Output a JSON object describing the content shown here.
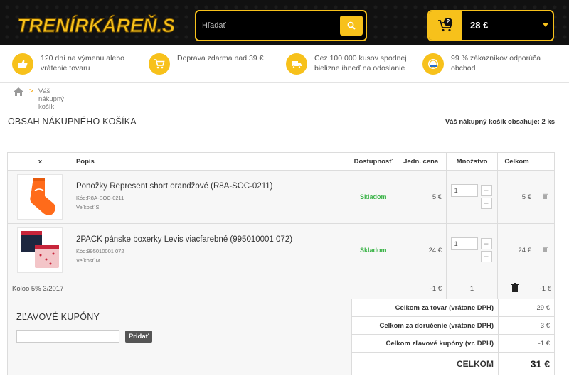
{
  "header": {
    "logo_text": "TRENÍRKÁREŇ.SK",
    "search_placeholder": "Hľadať",
    "cart_count": "2",
    "cart_total": "28 €"
  },
  "benefits": [
    {
      "icon": "thumbs-up-icon",
      "text": "120 dní na výmenu alebo vrátenie tovaru"
    },
    {
      "icon": "cart-icon",
      "text": "Doprava zdarma nad 39 €"
    },
    {
      "icon": "truck-icon",
      "text": "Cez 100 000 kusov spodnej bielizne ihneď na odoslanie"
    },
    {
      "icon": "badge-icon",
      "text": "99 % zákazníkov odporúča obchod"
    }
  ],
  "breadcrumb": {
    "separator": ">",
    "current": "Váš nákupný košík"
  },
  "page_title": "OBSAH NÁKUPNÉHO KOŠÍKA",
  "cart_info": "Váš nákupný košík obsahuje: 2 ks",
  "table": {
    "headers": [
      "x",
      "Popis",
      "Dostupnosť",
      "Jedn. cena",
      "Množstvo",
      "Celkom",
      ""
    ],
    "items": [
      {
        "name": "Ponožky Represent short orandžové (R8A-SOC-0211)",
        "code": "Kód:R8A-SOC-0211",
        "size": "Veľkosť:S",
        "stock": "Skladom",
        "unit_price": "5 €",
        "qty": "1",
        "total": "5 €",
        "plus": "+",
        "minus": "−"
      },
      {
        "name": "2PACK pánske boxerky Levis viacfarebné (995010001 072)",
        "code": "Kód:995010001 072",
        "size": "Veľkosť:M",
        "stock": "Skladom",
        "unit_price": "24 €",
        "qty": "1",
        "total": "24 €",
        "plus": "+",
        "minus": "−"
      }
    ],
    "promo": {
      "name": "Koloo 5% 3/2017",
      "unit_price": "-1 €",
      "qty": "1",
      "total": "-1 €"
    }
  },
  "coupons": {
    "title": "ZĽAVOVÉ KUPÓNY",
    "button": "Pridať"
  },
  "totals": [
    {
      "label": "Celkom za tovar (vrátane DPH)",
      "value": "29 €"
    },
    {
      "label": "Celkom za doručenie (vrátane DPH)",
      "value": "3 €"
    },
    {
      "label": "Celkom zľavové kupóny (vr. DPH)",
      "value": "-1 €"
    }
  ],
  "grand_total": {
    "label": "CELKOM",
    "value": "31 €"
  },
  "colors": {
    "accent": "#f7c11b",
    "stock": "#3cb449",
    "header_bg": "#111111"
  }
}
